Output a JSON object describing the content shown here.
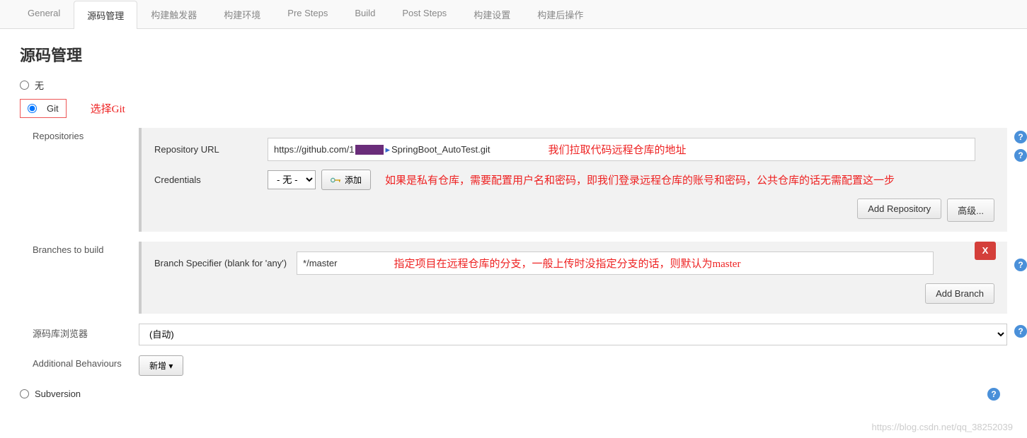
{
  "tabs": [
    "General",
    "源码管理",
    "构建触发器",
    "构建环境",
    "Pre Steps",
    "Build",
    "Post Steps",
    "构建设置",
    "构建后操作"
  ],
  "active_tab": "源码管理",
  "page_title": "源码管理",
  "scm": {
    "none_label": "无",
    "git_label": "Git",
    "git_note": "选择Git",
    "subversion_label": "Subversion"
  },
  "repos": {
    "section_label": "Repositories",
    "url_label": "Repository URL",
    "url_prefix": "https://github.com/1",
    "url_suffix": "SpringBoot_AutoTest.git",
    "url_note": "我们拉取代码远程仓库的地址",
    "cred_label": "Credentials",
    "cred_value": "- 无 -",
    "add_label": "添加",
    "cred_note": "如果是私有仓库，需要配置用户名和密码，即我们登录远程仓库的账号和密码，公共仓库的话无需配置这一步",
    "advanced_btn": "高级...",
    "add_repo_btn": "Add Repository"
  },
  "branches": {
    "section_label": "Branches to build",
    "spec_label": "Branch Specifier (blank for 'any')",
    "spec_value": "*/master",
    "spec_note": "指定项目在远程仓库的分支，一般上传时没指定分支的话，则默认为master",
    "delete_label": "X",
    "add_branch_btn": "Add Branch"
  },
  "browser": {
    "label": "源码库浏览器",
    "value": "(自动)"
  },
  "additional": {
    "label": "Additional Behaviours",
    "new_btn": "新增"
  },
  "help_symbol": "?",
  "watermark": "https://blog.csdn.net/qq_38252039"
}
